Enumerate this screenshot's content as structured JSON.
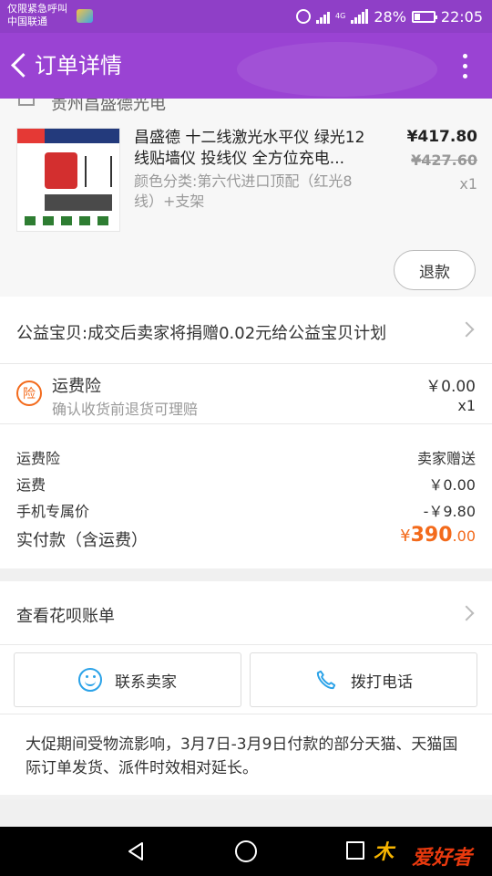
{
  "status_bar": {
    "carrier_line1": "仅限紧急呼叫",
    "carrier_line2": "中国联通",
    "network": "4G",
    "battery": "28%",
    "battery_level": 0.28,
    "time": "22:05"
  },
  "nav": {
    "title": "订单详情"
  },
  "store": {
    "name": "贵州昌盛德光电"
  },
  "product": {
    "title": "昌盛德 十二线激光水平仪 绿光12线贴墙仪 投线仪 全方位充电...",
    "spec": "颜色分类:第六代进口顶配（红光8线）+支架",
    "price": "¥417.80",
    "original_price": "¥427.60",
    "quantity": "x1",
    "refund_label": "退款"
  },
  "charity": {
    "text": "公益宝贝:成交后卖家将捐赠0.02元给公益宝贝计划"
  },
  "insurance": {
    "icon_text": "险",
    "title": "运费险",
    "subtitle": "确认收货前退货可理赔",
    "price": "￥0.00",
    "quantity": "x1"
  },
  "summary": {
    "rows": [
      {
        "label": "运费险",
        "value": "卖家赠送"
      },
      {
        "label": "运费",
        "value": "￥0.00"
      },
      {
        "label": "手机专属价",
        "value": "-￥9.80"
      }
    ],
    "total_label": "实付款（含运费）",
    "total_currency": "¥",
    "total_integer": "390",
    "total_decimal": ".00"
  },
  "huabei": {
    "text": "查看花呗账单"
  },
  "actions": {
    "contact_label": "联系卖家",
    "call_label": "拨打电话"
  },
  "notice": {
    "text": "大促期间受物流影响，3月7日-3月9日付款的部分天猫、天猫国际订单发货、派件时效相对延长。"
  },
  "watermark": {
    "text": "爱好者",
    "brand_char": "木"
  },
  "colors": {
    "nav_purple": "#9a43d3",
    "accent_orange": "#f36a1b",
    "icon_blue": "#2aa2e8"
  }
}
